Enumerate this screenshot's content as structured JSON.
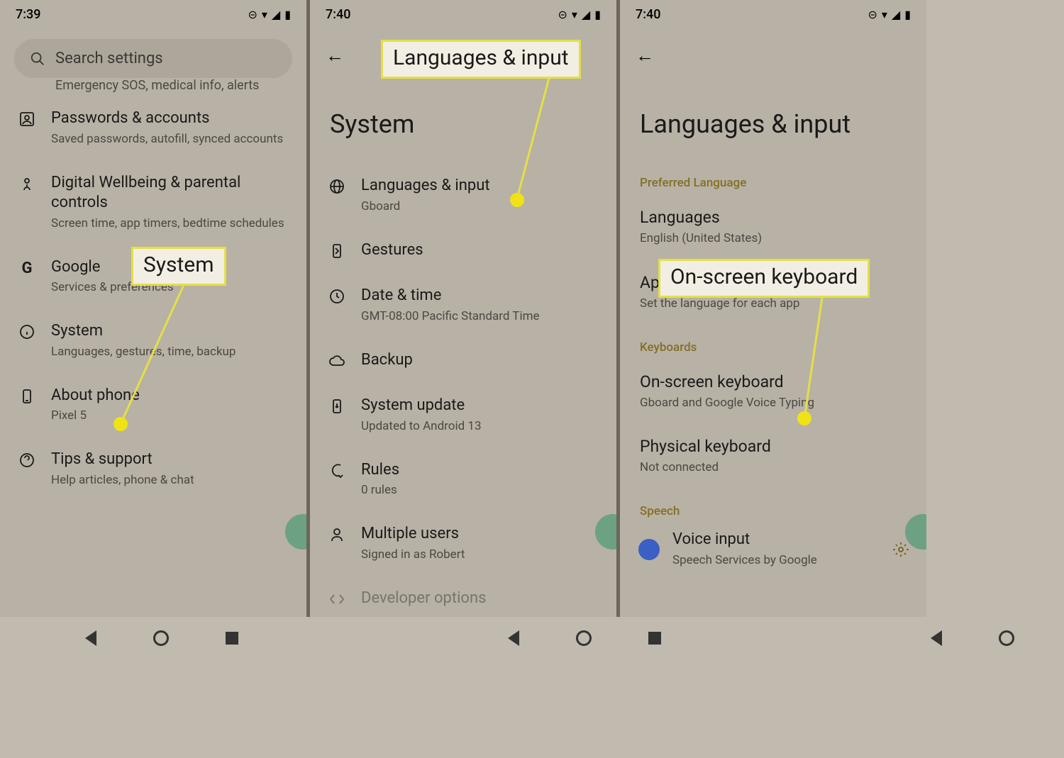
{
  "panel1": {
    "time": "7:39",
    "search_placeholder": "Search settings",
    "frag_sub": "Emergency SOS, medical info, alerts",
    "items": [
      {
        "title": "Passwords & accounts",
        "sub": "Saved passwords, autofill, synced accounts"
      },
      {
        "title": "Digital Wellbeing & parental controls",
        "sub": "Screen time, app timers, bedtime schedules"
      },
      {
        "title": "Google",
        "sub": "Services & preferences"
      },
      {
        "title": "System",
        "sub": "Languages, gestures, time, backup"
      },
      {
        "title": "About phone",
        "sub": "Pixel 5"
      },
      {
        "title": "Tips & support",
        "sub": "Help articles, phone & chat"
      }
    ],
    "callout": "System"
  },
  "panel2": {
    "time": "7:40",
    "title": "System",
    "items": [
      {
        "title": "Languages & input",
        "sub": "Gboard"
      },
      {
        "title": "Gestures",
        "sub": ""
      },
      {
        "title": "Date & time",
        "sub": "GMT-08:00 Pacific Standard Time"
      },
      {
        "title": "Backup",
        "sub": ""
      },
      {
        "title": "System update",
        "sub": "Updated to Android 13"
      },
      {
        "title": "Rules",
        "sub": "0 rules"
      },
      {
        "title": "Multiple users",
        "sub": "Signed in as Robert"
      },
      {
        "title": "Developer options",
        "sub": ""
      }
    ],
    "callout": "Languages & input"
  },
  "panel3": {
    "time": "7:40",
    "title": "Languages & input",
    "section_pref": "Preferred Language",
    "languages_title": "Languages",
    "languages_sub": "English (United States)",
    "app_lang_title": "App Languages",
    "app_lang_sub": "Set the language for each app",
    "section_keyboards": "Keyboards",
    "onscreen_title": "On-screen keyboard",
    "onscreen_sub": "Gboard and Google Voice Typing",
    "physical_title": "Physical keyboard",
    "physical_sub": "Not connected",
    "section_speech": "Speech",
    "voice_title": "Voice input",
    "voice_sub": "Speech Services by Google",
    "callout": "On-screen keyboard"
  }
}
